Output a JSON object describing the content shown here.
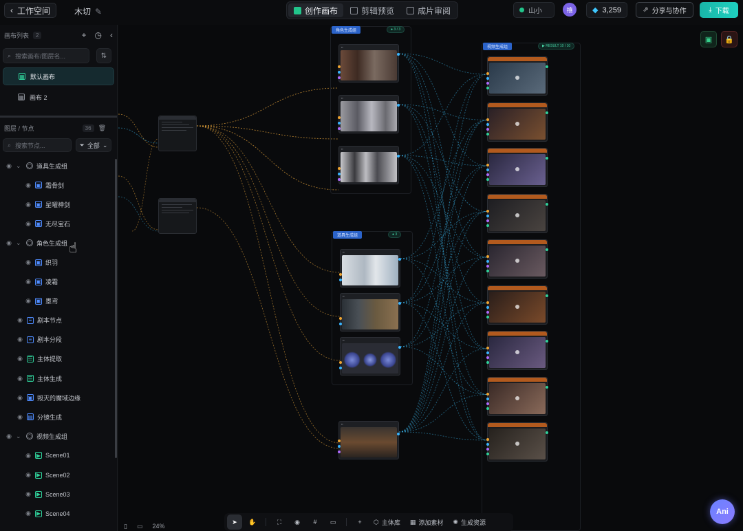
{
  "topbar": {
    "back_label": "工作空间",
    "project_name": "木切",
    "tabs": [
      {
        "label": "创作画布",
        "color": "#22c58b",
        "active": true
      },
      {
        "label": "剪辑预览",
        "color": "#6b7280",
        "active": false
      },
      {
        "label": "成片审阅",
        "color": "#6b7280",
        "active": false
      }
    ],
    "status_label": "山小",
    "avatar_letter": "禧",
    "credits": "3,259",
    "share_label": "分享与协作",
    "download_label": "下载"
  },
  "sidebar": {
    "canvas_section_title": "画布列表",
    "canvas_count": "2",
    "search_placeholder": "搜索画布/图层名...",
    "canvases": [
      {
        "label": "默认画布",
        "active": true
      },
      {
        "label": "画布 2",
        "active": false
      }
    ],
    "nodes_section_title": "图层 / 节点",
    "nodes_count": "36",
    "node_search_placeholder": "搜索节点...",
    "filter_label": "全部",
    "tree": [
      {
        "label": "道具生成组",
        "level": 0,
        "type": "group",
        "expanded": true
      },
      {
        "label": "霜骨剑",
        "level": 1,
        "type": "image"
      },
      {
        "label": "星曜神剑",
        "level": 1,
        "type": "image"
      },
      {
        "label": "无尽宝石",
        "level": 1,
        "type": "image"
      },
      {
        "label": "角色生成组",
        "level": 0,
        "type": "group",
        "expanded": true
      },
      {
        "label": "织羽",
        "level": 1,
        "type": "image"
      },
      {
        "label": "凌霜",
        "level": 1,
        "type": "image"
      },
      {
        "label": "墨鸢",
        "level": 1,
        "type": "image"
      },
      {
        "label": "剧本节点",
        "level": 0,
        "type": "doc"
      },
      {
        "label": "剧本分段",
        "level": 0,
        "type": "doc"
      },
      {
        "label": "主体提取",
        "level": 0,
        "type": "list"
      },
      {
        "label": "主体生成",
        "level": 0,
        "type": "list"
      },
      {
        "label": "毁灭的魔域边缘",
        "level": 0,
        "type": "image"
      },
      {
        "label": "分镜生成",
        "level": 0,
        "type": "film"
      },
      {
        "label": "视频生成组",
        "level": 0,
        "type": "group",
        "expanded": true
      },
      {
        "label": "Scene01",
        "level": 1,
        "type": "video"
      },
      {
        "label": "Scene02",
        "level": 1,
        "type": "video"
      },
      {
        "label": "Scene03",
        "level": 1,
        "type": "video"
      },
      {
        "label": "Scene04",
        "level": 1,
        "type": "video"
      }
    ]
  },
  "canvas": {
    "group_labels": [
      "角色生成组",
      "道具生成组",
      "视频生成组"
    ],
    "group_badges": [
      "● 3 / 3",
      "● 3",
      "▶ RESULT 10 / 10"
    ],
    "card_labels": [
      "剧本",
      "剧本分段"
    ],
    "wire_colors": {
      "orange": "#e3a23a",
      "blue": "#37a8d8"
    }
  },
  "bottom": {
    "zoom": "24%",
    "tools": [
      "主体库",
      "添加素材",
      "生成资源"
    ]
  },
  "assistant_label": "Ani"
}
